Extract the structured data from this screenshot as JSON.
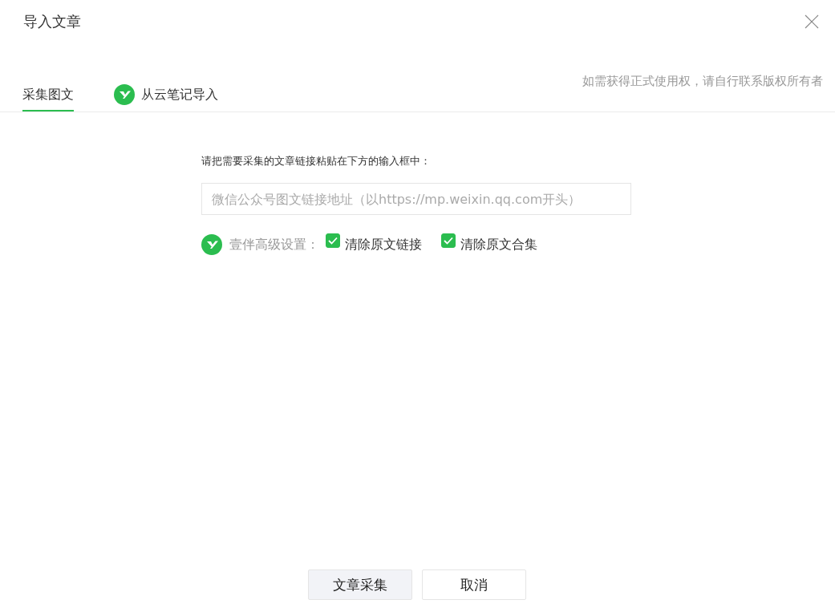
{
  "window": {
    "title": "导入文章"
  },
  "tabs": [
    {
      "label": "采集图文",
      "selected": true,
      "kind": "plain"
    },
    {
      "label": "从云笔记导入",
      "selected": false,
      "kind": "logo"
    }
  ],
  "notice": "如需获得正式使用权，请自行联系版权所有者",
  "form": {
    "instruction": "请把需要采集的文章链接粘贴在下方的输入框中：",
    "url_field": {
      "placeholder": "微信公众号图文链接地址（以https://mp.weixin.qq.com开头）"
    },
    "advanced_label": "壹伴高级设置：",
    "options": [
      {
        "label": "清除原文链接",
        "checked": true
      },
      {
        "label": "清除原文合集",
        "checked": true
      }
    ]
  },
  "buttons": [
    {
      "label": "文章采集",
      "kind": "primary"
    },
    {
      "label": "取消",
      "kind": "secondary"
    }
  ]
}
